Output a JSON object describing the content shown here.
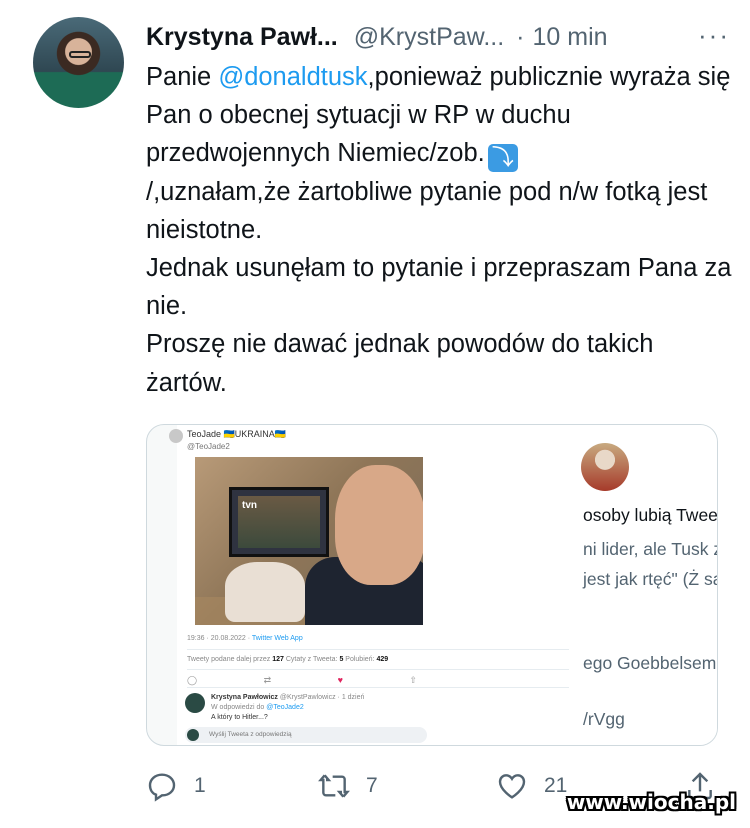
{
  "tweet": {
    "author_name": "Krystyna Pawł...",
    "handle": "@KrystPaw...",
    "separator": "·",
    "time": "10 min",
    "more": "···",
    "text_parts": {
      "p1": "Panie ",
      "mention": "@donaldtusk",
      "p2": ",ponieważ publicznie wyraża się Pan o obecnej sytuacji w RP w duchu przedwojennych Niemiec/zob.",
      "arrow": "⤵",
      "p3": "/,uznałam,że żartobliwe pytanie pod n/w fotką jest nieistotne.",
      "p4": "Jednak usunęłam to pytanie i przepraszam Pana za nie.",
      "p5": "Proszę nie dawać jednak powodów do takich żartów."
    }
  },
  "media": {
    "left": {
      "author": "TeoJade 🇺🇦UKRAINA🇺🇦",
      "handle": "@TeoJade2",
      "tvn_logo": "tvn",
      "timestamp": "19:36 · 20.08.2022 · ",
      "source": "Twitter Web App",
      "stats_prefix": "Tweety podane dalej przez ",
      "retweets": "127",
      "quotes_label": " Cytaty z Tweeta: ",
      "quotes": "5",
      "likes_label": " Polubień: ",
      "likes": "429",
      "reply_author": "Krystyna Pawłowicz",
      "reply_handle": " @KrystPawlowicz · 1 dzień",
      "reply_to_prefix": "W odpowiedzi do ",
      "reply_to": "@TeoJade2",
      "reply_text": "A który to Hitler...?",
      "compose_placeholder": "Wyślij Tweeta z odpowiedzią"
    },
    "right": {
      "line1": "osoby lubią Tweeta, w którym",
      "line2": "ni lider, ale Tusk z żelazną miot",
      "line3": "jest jak rtęć\" (Ż są jak tyfus) s",
      "line4": "ego Goebbelsem, bo jedzie mo",
      "line5": "/rVgg"
    }
  },
  "actions": {
    "replies": "1",
    "retweets": "7",
    "likes": "21"
  },
  "watermark": "www.wiocha.pl"
}
